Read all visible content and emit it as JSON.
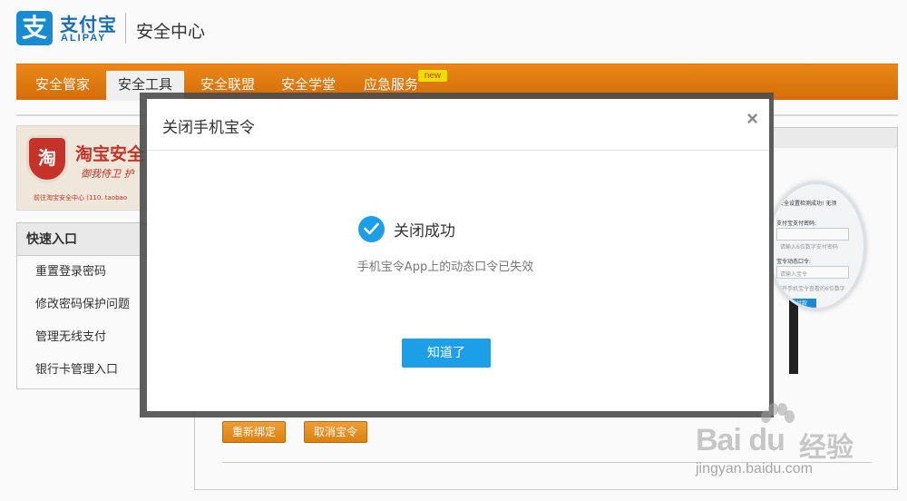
{
  "header": {
    "logo_mark": "支",
    "logo_cn": "支付宝",
    "logo_en": "ALIPAY",
    "title": "安全中心"
  },
  "nav": {
    "items": [
      {
        "label": "安全管家",
        "active": false
      },
      {
        "label": "安全工具",
        "active": true
      },
      {
        "label": "安全联盟",
        "active": false
      },
      {
        "label": "安全学堂",
        "active": false
      },
      {
        "label": "应急服务",
        "active": false
      }
    ],
    "badge": "new"
  },
  "banner": {
    "shield_char": "淘",
    "title": "淘宝安全",
    "motto": "御我侍卫  护",
    "link": "前往淘宝安全中心 (110. taobao"
  },
  "quick": {
    "heading": "快速入口",
    "items": [
      "重置登录密码",
      "修改密码保护问题",
      "管理无线支付",
      "银行卡管理入口"
    ]
  },
  "main": {
    "rebind_label": "重新绑定",
    "cancel_label": "取消宝令"
  },
  "illustration": {
    "line1": "安全设置检测成功! 无须",
    "line2": "支付宝支付密码:",
    "line3": "请输入6位数字支付密码",
    "line4": "宝令动态口令:",
    "line5": "请输入宝令",
    "line6": "打开手机宝令查看的6位数字",
    "btn": "确认付款"
  },
  "modal": {
    "title": "关闭手机宝令",
    "close_glyph": "×",
    "success_title": "关闭成功",
    "success_desc": "手机宝令App上的动态口令已失效",
    "ok_label": "知道了"
  },
  "watermark": {
    "logo": "Bai du",
    "cn": "经验",
    "url": "jingyan.baidu.com"
  },
  "colors": {
    "alipay_blue": "#1a8fd6",
    "nav_orange": "#e8800f",
    "primary_button": "#1c9ee8",
    "taobao_red": "#c9342a"
  }
}
